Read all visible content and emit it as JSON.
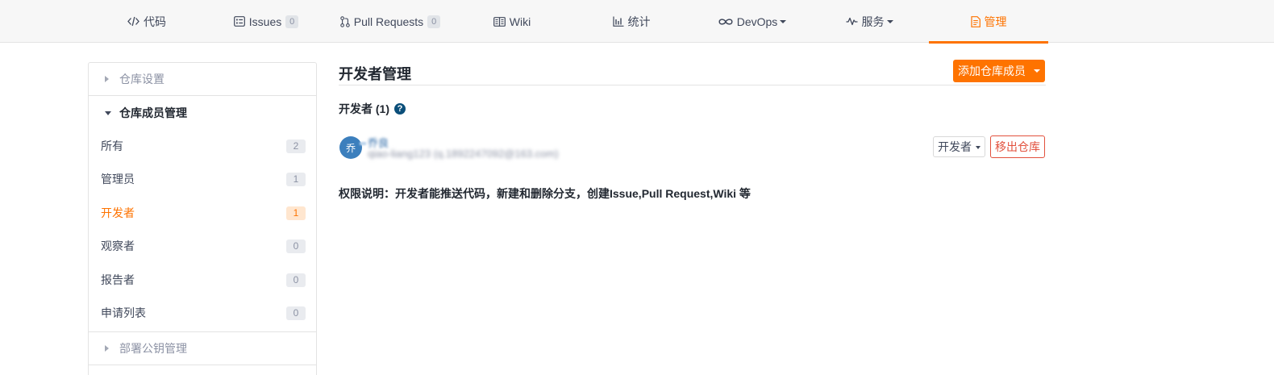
{
  "tabs": [
    {
      "label": "代码",
      "icon": "code-icon"
    },
    {
      "label": "Issues",
      "count": "0",
      "icon": "issues-icon"
    },
    {
      "label": "Pull Requests",
      "count": "0",
      "icon": "pull-request-icon"
    },
    {
      "label": "Wiki",
      "icon": "wiki-icon"
    },
    {
      "label": "统计",
      "icon": "chart-icon"
    },
    {
      "label": "DevOps",
      "icon": "infinity-icon",
      "dropdown": true
    },
    {
      "label": "服务",
      "icon": "pulse-icon",
      "dropdown": true
    },
    {
      "label": "管理",
      "icon": "document-icon",
      "active": true
    }
  ],
  "sidebar": {
    "sections": [
      {
        "label": "仓库设置",
        "expanded": false
      },
      {
        "label": "仓库成员管理",
        "expanded": true
      },
      {
        "label": "部署公钥管理",
        "expanded": false
      }
    ],
    "items": [
      {
        "label": "所有",
        "count": "2"
      },
      {
        "label": "管理员",
        "count": "1"
      },
      {
        "label": "开发者",
        "count": "1",
        "active": true
      },
      {
        "label": "观察者",
        "count": "0"
      },
      {
        "label": "报告者",
        "count": "0"
      },
      {
        "label": "申请列表",
        "count": "0"
      }
    ]
  },
  "main": {
    "title": "开发者管理",
    "add_button": "添加仓库成员",
    "subtitle": "开发者 (1)",
    "help": "?",
    "member": {
      "avatar_text": "乔",
      "name": "乔良",
      "account": "qiao-liang123",
      "email": "(q.1892247092@163.com)",
      "role": "开发者",
      "remove_button": "移出仓库"
    },
    "permission_note": "权限说明：开发者能推送代码，新建和删除分支，创建Issue,Pull Request,Wiki 等"
  },
  "colors": {
    "accent": "#fe7300",
    "danger": "#e2513d",
    "text": "#40485b",
    "muted": "#8c92a4",
    "avatar": "#3c7fbd"
  }
}
